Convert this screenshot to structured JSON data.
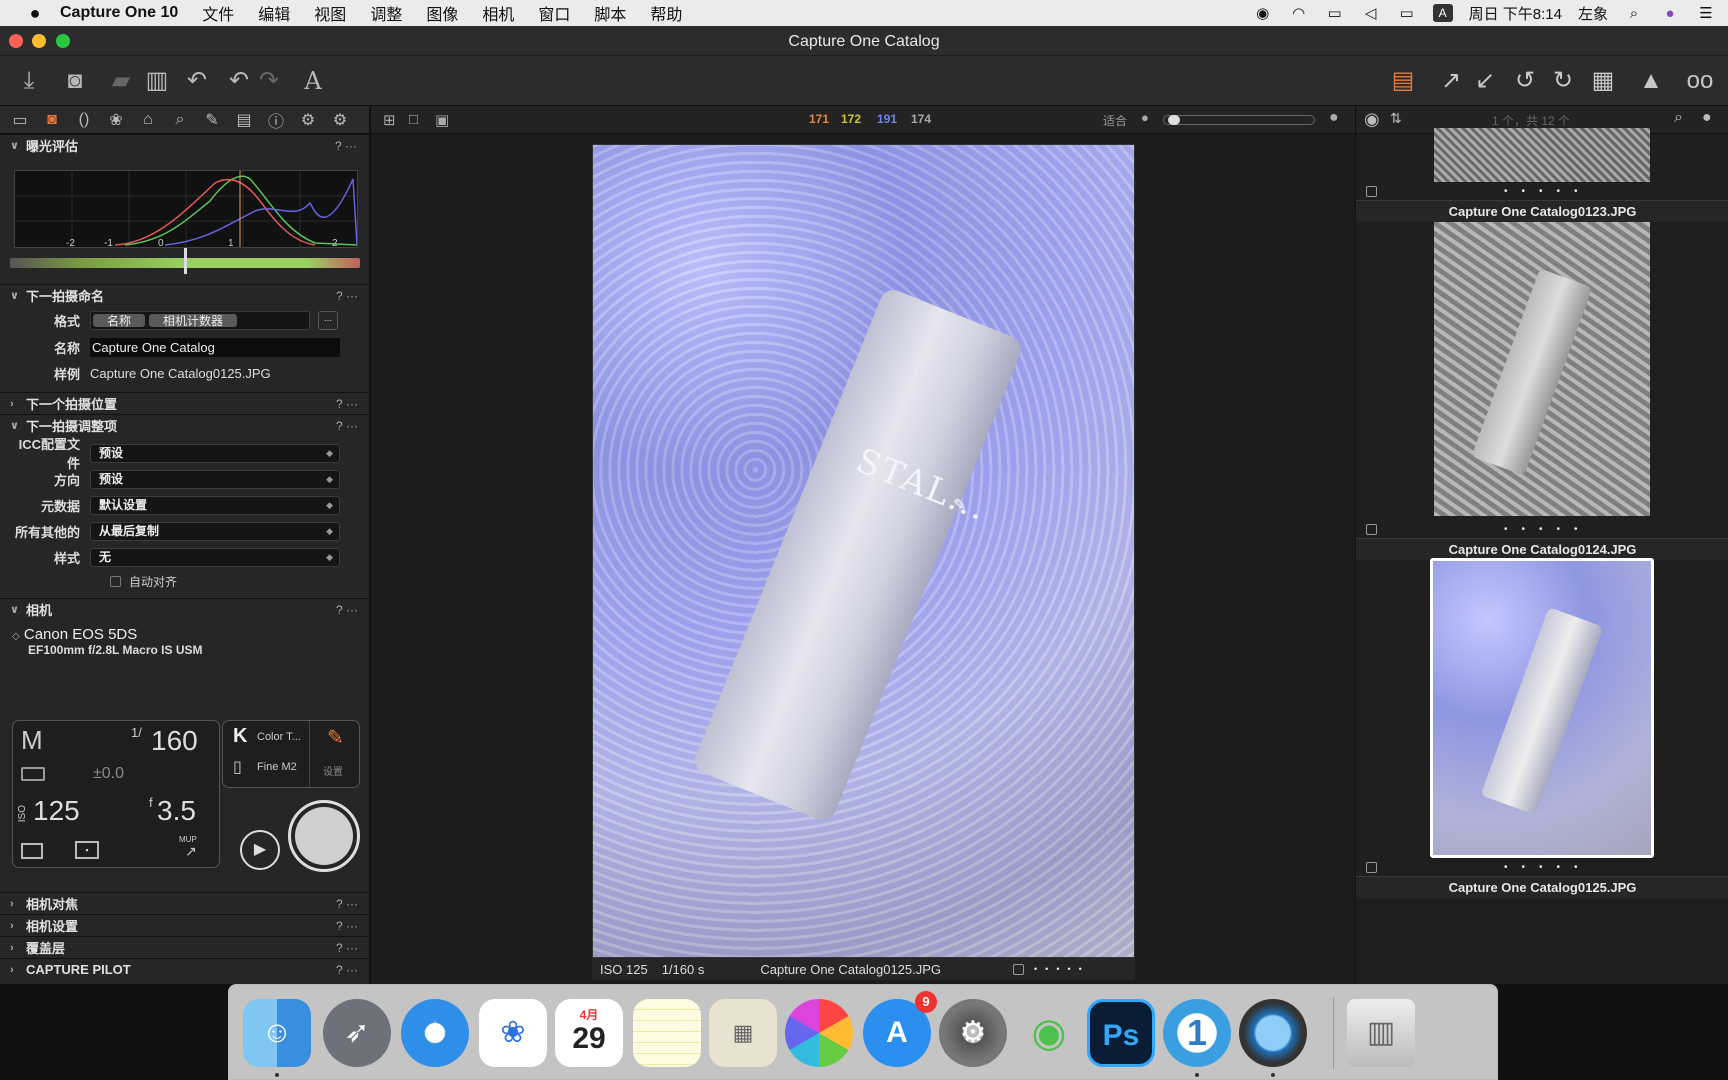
{
  "menubar": {
    "app_name": "Capture One 10",
    "menus": [
      "文件",
      "编辑",
      "视图",
      "调整",
      "图像",
      "相机",
      "窗口",
      "脚本",
      "帮助"
    ],
    "clock": "周日 下午8:14",
    "user": "左象",
    "input_method": "A"
  },
  "window": {
    "title": "Capture One Catalog"
  },
  "exposure": {
    "section": "曝光评估",
    "scale": [
      "-2",
      "-1",
      "0",
      "1",
      "2"
    ]
  },
  "naming": {
    "section": "下一拍摄命名",
    "format_label": "格式",
    "token1": "名称",
    "token2": "相机计数器",
    "more": "...",
    "name_label": "名称",
    "name_value": "Capture One Catalog",
    "sample_label": "样例",
    "sample_value": "Capture One Catalog0125.JPG"
  },
  "sections": {
    "next_location": "下一个拍摄位置",
    "next_adjust": "下一拍摄调整项",
    "camera": "相机",
    "camera_focus": "相机对焦",
    "camera_settings": "相机设置",
    "overlay": "覆盖层",
    "capture_pilot": "CAPTURE PILOT"
  },
  "adjust": {
    "icc_label": "ICC配置文件",
    "icc_value": "预设",
    "orient_label": "方向",
    "orient_value": "预设",
    "meta_label": "元数据",
    "meta_value": "默认设置",
    "other_label": "所有其他的",
    "other_value": "从最后复制",
    "style_label": "样式",
    "style_value": "无",
    "auto_align": "自动对齐"
  },
  "camera": {
    "model": "Canon EOS 5DS",
    "lens": "EF100mm f/2.8L Macro IS USM",
    "mode": "M",
    "shutter_prefix": "1/",
    "shutter": "160",
    "ev": "±0.0",
    "iso_label": "ISO",
    "iso": "125",
    "aperture_prefix": "f",
    "aperture": "3.5",
    "mup": "MUP",
    "wb": "K",
    "color_temp": "Color T...",
    "quality": "Fine M2",
    "settings": "设置"
  },
  "viewer": {
    "counts": [
      "171",
      "172",
      "191",
      "174"
    ],
    "fit_label": "适合",
    "caption_iso": "ISO 125",
    "caption_shutter": "1/160 s",
    "caption_file": "Capture One Catalog0125.JPG",
    "brand_text": "STAL..."
  },
  "browser": {
    "count_text": "1 个，共 12 个",
    "thumbs": [
      "Capture One Catalog0123.JPG",
      "Capture One Catalog0124.JPG",
      "Capture One Catalog0125.JPG"
    ]
  },
  "dock": {
    "calendar_month": "4月",
    "calendar_day": "29",
    "appstore_badge": "9"
  },
  "colors": {
    "accent": "#e87a3a",
    "count_orange": "#e2884b",
    "count_yellow": "#d5c23c",
    "count_blue": "#6f87e8"
  }
}
